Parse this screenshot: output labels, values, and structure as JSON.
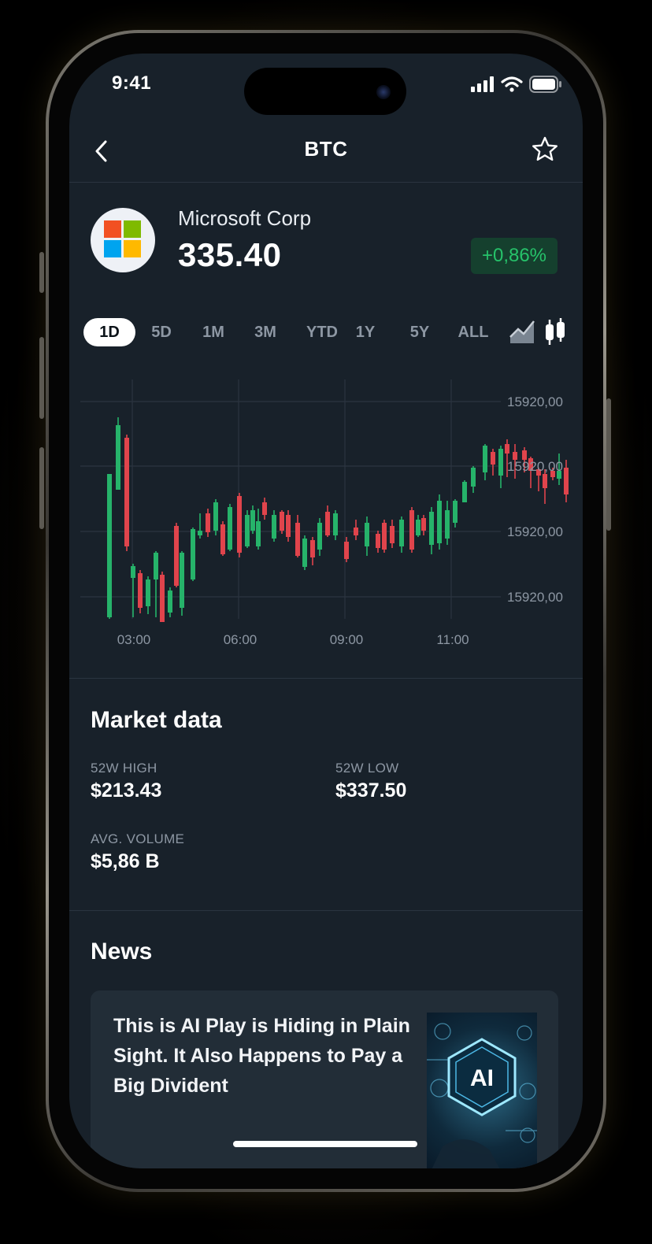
{
  "status_bar": {
    "time": "9:41"
  },
  "header": {
    "title": "BTC"
  },
  "stock": {
    "company": "Microsoft Corp",
    "price": "335.40",
    "change": "+0,86%"
  },
  "ranges": [
    "1D",
    "5D",
    "1M",
    "3M",
    "YTD",
    "1Y",
    "5Y",
    "ALL"
  ],
  "active_range": "1D",
  "chart_data": {
    "type": "candlestick",
    "x_ticks": [
      "03:00",
      "06:00",
      "09:00",
      "11:00"
    ],
    "y_ticks": [
      "15920,00",
      "15920,00",
      "15920,00",
      "15920,00"
    ],
    "grid": true,
    "up_color": "#26b36a",
    "down_color": "#e0444c"
  },
  "market": {
    "title": "Market data",
    "items": [
      {
        "label": "52W HIGH",
        "value": "$213.43"
      },
      {
        "label": "52W LOW",
        "value": "$337.50"
      },
      {
        "label": "AVG. VOLUME",
        "value": "$5,86 B"
      }
    ]
  },
  "news": {
    "title": "News",
    "items": [
      {
        "headline": "This is AI Play is Hiding in Plain Sight. It Also Happens to Pay a Big Divident",
        "image_text": "AI"
      }
    ]
  },
  "colors": {
    "background": "#18212a",
    "positive": "#26c26a",
    "negative": "#e0444c"
  }
}
